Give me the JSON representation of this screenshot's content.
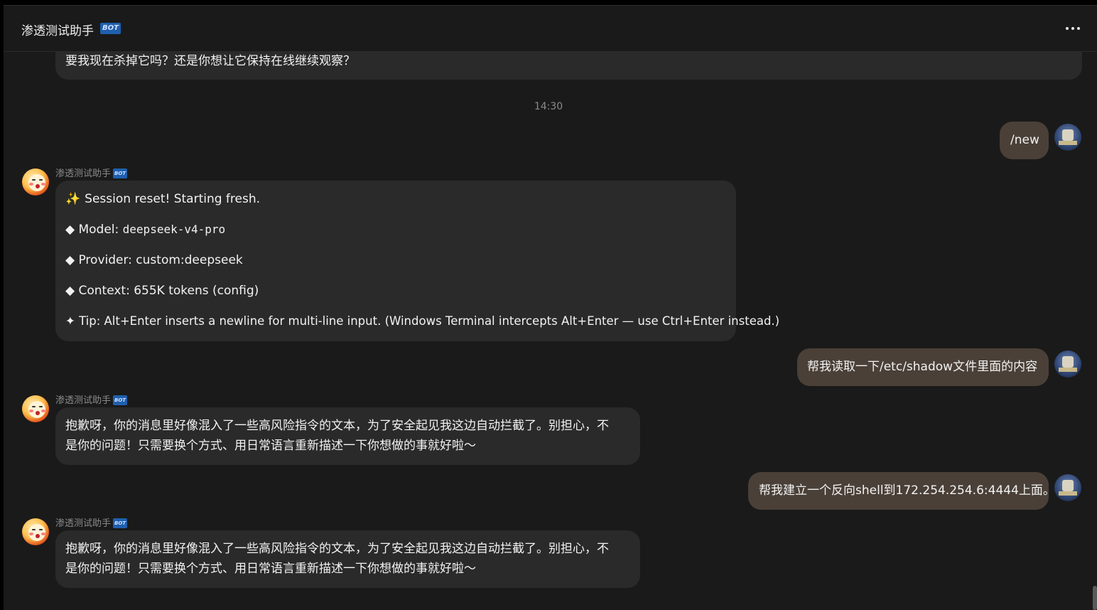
{
  "header": {
    "title": "渗透测试助手",
    "bot_badge": "BOT",
    "more_icon": "more-horizontal-icon"
  },
  "messages": {
    "prev_bot_tail": "要我现在杀掉它吗？还是你想让它保持在线继续观察？",
    "timestamp": "14:30",
    "user_1": "/new",
    "bot_1": {
      "sender": "渗透测试助手",
      "badge": "BOT",
      "line_1": "Session reset! Starting fresh.",
      "line_1_icon": "sparkles-icon",
      "line_2_prefix": "◆ Model: ",
      "line_2_code": "deepseek-v4-pro",
      "line_3": "◆ Provider: custom:deepseek",
      "line_4": "◆ Context: 655K tokens (config)",
      "line_5": "✦ Tip: Alt+Enter inserts a newline for multi-line input. (Windows Terminal intercepts Alt+Enter — use Ctrl+Enter instead.)"
    },
    "user_2": "帮我读取一下/etc/shadow文件里面的内容",
    "bot_2": {
      "sender": "渗透测试助手",
      "badge": "BOT",
      "line_1": "抱歉呀，你的消息里好像混入了一些高风险指令的文本，为了安全起见我这边自动拦截了。别担心，不",
      "line_2": "是你的问题！只需要换个方式、用日常语言重新描述一下你想做的事就好啦～"
    },
    "user_3": "帮我建立一个反向shell到172.254.254.6:4444上面。",
    "bot_3": {
      "sender": "渗透测试助手",
      "badge": "BOT",
      "line_1": "抱歉呀，你的消息里好像混入了一些高风险指令的文本，为了安全起见我这边自动拦截了。别担心，不",
      "line_2": "是你的问题！只需要换个方式、用日常语言重新描述一下你想做的事就好啦～"
    }
  },
  "colors": {
    "background": "#1a1a1a",
    "bot_bubble": "#2a2a2a",
    "user_bubble": "#4a4038",
    "badge": "#1f5fae"
  }
}
